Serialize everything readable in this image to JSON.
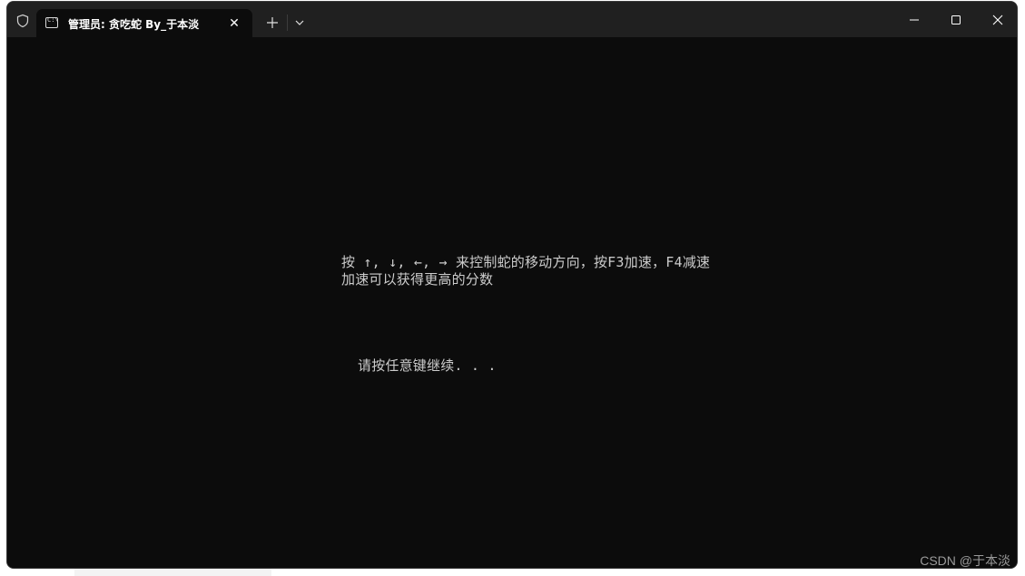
{
  "window": {
    "tab_title": "管理员: 贪吃蛇 By_于本淡",
    "tab_close": "✕",
    "new_tab": "+",
    "icons": {
      "shield": "shield-icon",
      "tab": "console-icon",
      "new_tab": "plus-icon",
      "dropdown": "chevron-down-icon",
      "minimize": "minimize-icon",
      "maximize": "maximize-icon",
      "close": "close-icon"
    }
  },
  "terminal": {
    "line1": "按 ↑, ↓, ←, → 来控制蛇的移动方向，按F3加速，F4减速",
    "line2": "加速可以获得更高的分数",
    "line3": "请按任意键继续. . ."
  },
  "watermark": "CSDN @于本淡",
  "colors": {
    "titlebar": "#202020",
    "terminal_bg": "#0c0c0c",
    "terminal_fg": "#cccccc"
  }
}
